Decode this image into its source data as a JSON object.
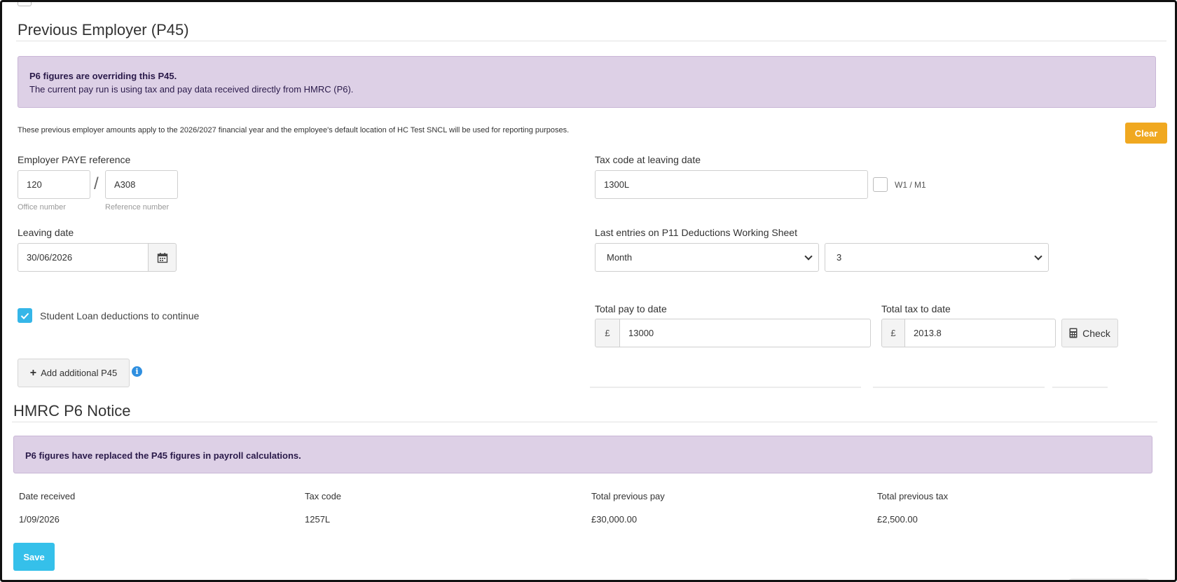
{
  "p45": {
    "title": "Previous Employer (P45)",
    "alert": {
      "heading": "P6 figures are overriding this P45.",
      "body": "The current pay run is using tax and pay data received directly from HMRC (P6)."
    },
    "note": "These previous employer amounts apply to the 2026/2027 financial year and the employee's default location of HC Test SNCL will be used for reporting purposes.",
    "clear_label": "Clear",
    "paye": {
      "label": "Employer PAYE reference",
      "office_value": "120",
      "office_sublabel": "Office number",
      "separator": "/",
      "reference_value": "A308",
      "reference_sublabel": "Reference number"
    },
    "leaving_date": {
      "label": "Leaving date",
      "value": "30/06/2026"
    },
    "tax_code": {
      "label": "Tax code at leaving date",
      "value": "1300L",
      "w1m1_label": "W1 / M1",
      "w1m1_checked": false
    },
    "last_entries": {
      "label": "Last entries on P11 Deductions Working Sheet",
      "period_value": "Month",
      "number_value": "3"
    },
    "student_loan": {
      "label": "Student Loan deductions to continue",
      "checked": true
    },
    "total_pay": {
      "label": "Total pay to date",
      "currency": "£",
      "value": "13000"
    },
    "total_tax": {
      "label": "Total tax to date",
      "currency": "£",
      "value": "2013.8"
    },
    "check_label": "Check",
    "add_p45_label": "Add additional P45"
  },
  "p6": {
    "title": "HMRC P6 Notice",
    "alert": "P6 figures have replaced the P45 figures in payroll calculations.",
    "columns": [
      "Date received",
      "Tax code",
      "Total previous pay",
      "Total previous tax"
    ],
    "row": [
      "1/09/2026",
      "1257L",
      "£30,000.00",
      "£2,500.00"
    ]
  },
  "save_label": "Save",
  "colors": {
    "alert_bg": "#ddd0e6",
    "orange": "#f0a820",
    "blue": "#35c0ea"
  }
}
